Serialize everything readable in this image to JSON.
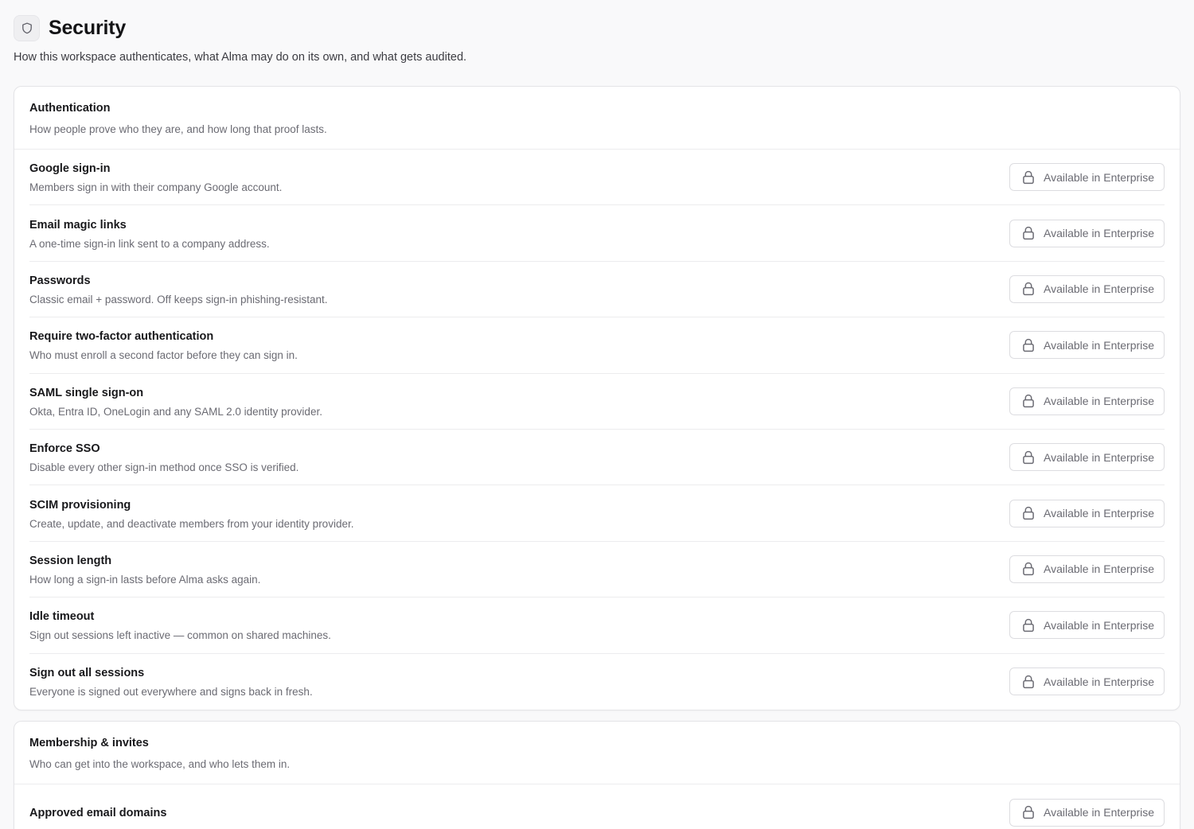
{
  "page": {
    "icon": "shield-icon",
    "title": "Security",
    "subtitle": "How this workspace authenticates, what Alma may do on its own, and what gets audited."
  },
  "sections": [
    {
      "title": "Authentication",
      "description": "How people prove who they are, and how long that proof lasts.",
      "rows": [
        {
          "title": "Google sign-in",
          "description": "Members sign in with their company Google account.",
          "badge": "Available in Enterprise"
        },
        {
          "title": "Email magic links",
          "description": "A one-time sign-in link sent to a company address.",
          "badge": "Available in Enterprise"
        },
        {
          "title": "Passwords",
          "description": "Classic email + password. Off keeps sign-in phishing-resistant.",
          "badge": "Available in Enterprise"
        },
        {
          "title": "Require two-factor authentication",
          "description": "Who must enroll a second factor before they can sign in.",
          "badge": "Available in Enterprise"
        },
        {
          "title": "SAML single sign-on",
          "description": "Okta, Entra ID, OneLogin and any SAML 2.0 identity provider.",
          "badge": "Available in Enterprise"
        },
        {
          "title": "Enforce SSO",
          "description": "Disable every other sign-in method once SSO is verified.",
          "badge": "Available in Enterprise"
        },
        {
          "title": "SCIM provisioning",
          "description": "Create, update, and deactivate members from your identity provider.",
          "badge": "Available in Enterprise"
        },
        {
          "title": "Session length",
          "description": "How long a sign-in lasts before Alma asks again.",
          "badge": "Available in Enterprise"
        },
        {
          "title": "Idle timeout",
          "description": "Sign out sessions left inactive — common on shared machines.",
          "badge": "Available in Enterprise"
        },
        {
          "title": "Sign out all sessions",
          "description": "Everyone is signed out everywhere and signs back in fresh.",
          "badge": "Available in Enterprise"
        }
      ]
    },
    {
      "title": "Membership & invites",
      "description": "Who can get into the workspace, and who lets them in.",
      "rows": [
        {
          "title": "Approved email domains",
          "description": "",
          "badge": "Available in Enterprise"
        }
      ]
    }
  ],
  "icons": {
    "badge_icon": "lock-icon"
  },
  "colors": {
    "background": "#f9f9fa",
    "card": "#ffffff",
    "muted_text": "#6b6b73",
    "border": "#e4e4e7"
  }
}
